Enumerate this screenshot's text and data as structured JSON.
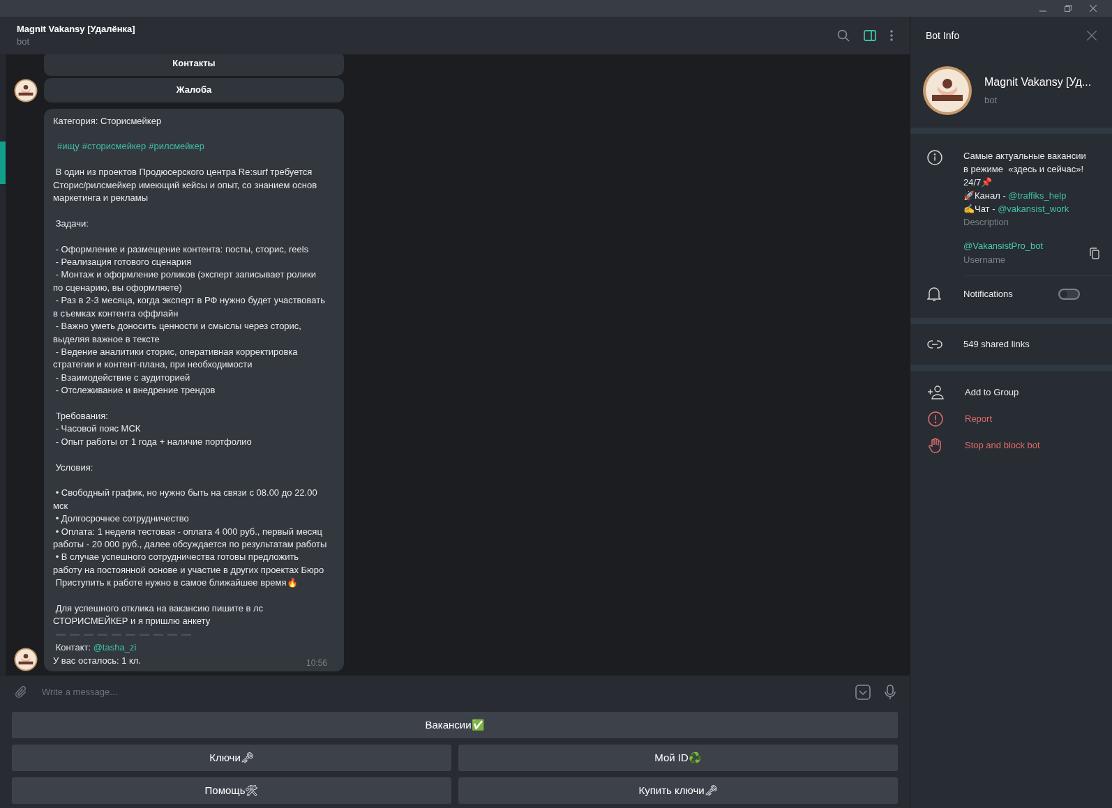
{
  "window": {
    "title": "Magnit Vakansy [Удалёнка]",
    "subtitle": "bot"
  },
  "header_tools": {
    "side_panel_on": true
  },
  "inline_buttons": [
    {
      "label": "Контакты",
      "avatar": false
    },
    {
      "label": "Жалоба",
      "avatar": true
    }
  ],
  "message": {
    "paragraphs": [
      {
        "kind": "text",
        "lines": [
          "Категория: Сторисмейкер"
        ]
      },
      {
        "kind": "hashtags",
        "tags": [
          "#ищу",
          "#сторисмейкер",
          "#рилсмейкер"
        ]
      },
      {
        "kind": "text",
        "lines": [
          " В один из проектов Продюсерского центра Re:surf требуется Сторис/рилсмейкер имеющий кейсы и опыт, со знанием основ маркетинга и рекламы"
        ]
      },
      {
        "kind": "text",
        "lines": [
          " Задачи:"
        ]
      },
      {
        "kind": "text",
        "lines": [
          " - Оформление и размещение контента: посты, сторис, reels",
          " - Реализация готового сценария",
          " - Монтаж и оформление роликов (эксперт записывает ролики по сценарию, вы оформляете)",
          " - Раз в 2-3 месяца, когда эксперт в РФ нужно будет участвовать в съемках контента оффлайн",
          " - Важно уметь доносить ценности и смыслы через сторис, выделяя важное в тексте",
          " - Ведение аналитики сторис, оперативная корректировка стратегии и контент-плана, при необходимости",
          " - Взаимодействие с аудиторией",
          " - Отслеживание и внедрение трендов"
        ]
      },
      {
        "kind": "text",
        "lines": [
          " Требования:",
          " - Часовой пояс МСК",
          " - Опыт работы от 1 года + наличие портфолио"
        ]
      },
      {
        "kind": "text",
        "lines": [
          " Условия:"
        ]
      },
      {
        "kind": "text",
        "lines": [
          " • Свободный график, но нужно быть на связи с 08.00 до 22.00 мск",
          " • Долгосрочное сотрудничество",
          " • Оплата: 1 неделя тестовая - оплата 4 000 руб., первый месяц работы - 20 000 руб., далее обсуждается по результатам работы",
          " • В случае успешного сотрудничества готовы предложить работу на постоянной основе и участие в других проектах Бюро",
          " Приступить к работе нужно в самое ближайшее время🔥"
        ]
      },
      {
        "kind": "text",
        "lines": [
          " Для успешного отклика на вакансию пишите в лс СТОРИСМЕЙКЕР и я пришлю анкету"
        ]
      }
    ],
    "contact": {
      "label": " Контакт: ",
      "link": "@tasha_zi"
    },
    "remaining": "У вас осталось: 1 кл.",
    "time": "10:56"
  },
  "composer": {
    "placeholder": "Write a message..."
  },
  "keyboard": [
    [
      "Вакансии✅"
    ],
    [
      "Ключи🗝",
      "Мой ID♻️"
    ],
    [
      "Помощь🛠",
      "Купить ключи🗝"
    ]
  ],
  "panel": {
    "title": "Bot Info",
    "name": "Magnit Vakansy [Уд...",
    "subtitle": "bot",
    "description": [
      [
        {
          "kind": "text",
          "text": "Самые актуальные вакансии в режиме  «здесь и сейчас»! 24/7📌"
        }
      ],
      [
        {
          "kind": "text",
          "text": "🚀Канал - "
        },
        {
          "kind": "link",
          "text": "@traffiks_help"
        }
      ],
      [
        {
          "kind": "text",
          "text": "✍Чат - "
        },
        {
          "kind": "link",
          "text": "@vakansist_work"
        }
      ]
    ],
    "description_label": "Description",
    "username": "@VakansistPro_bot",
    "username_label": "Username",
    "notifications": {
      "label": "Notifications",
      "on": false
    },
    "shared_links": "549 shared links",
    "actions": [
      {
        "kind": "add",
        "label": "Add to Group"
      },
      {
        "kind": "report",
        "label": "Report"
      },
      {
        "kind": "block",
        "label": "Stop and block bot"
      }
    ]
  }
}
